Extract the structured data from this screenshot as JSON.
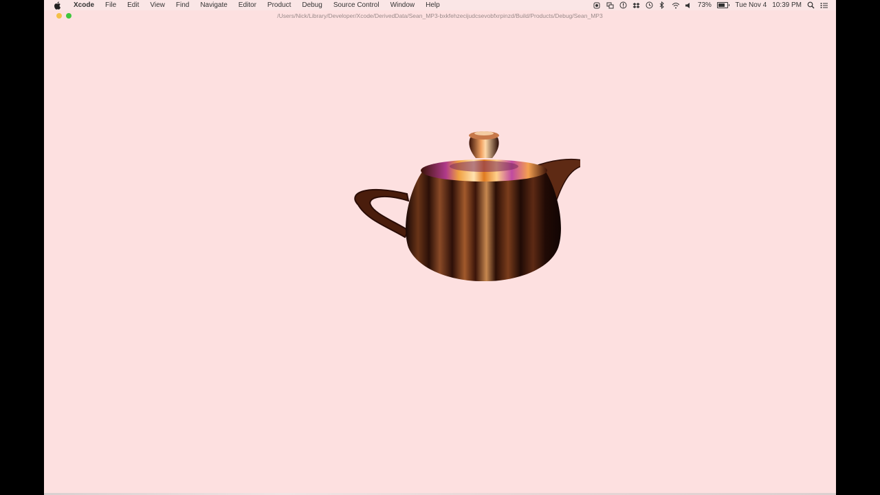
{
  "menubar": {
    "apple_icon": "apple-logo-icon",
    "app_name": "Xcode",
    "items": [
      "File",
      "Edit",
      "View",
      "Find",
      "Navigate",
      "Editor",
      "Product",
      "Debug",
      "Source Control",
      "Window",
      "Help"
    ],
    "status": {
      "battery_percent": "73%",
      "battery_level": 0.73,
      "date": "Tue Nov 4",
      "time": "10:39 PM",
      "icons": [
        "record-icon",
        "screens-icon",
        "info-icon",
        "dropbox-icon",
        "time-machine-icon",
        "bluetooth-icon",
        "wifi-icon",
        "volume-icon",
        "spotlight-icon",
        "notification-center-icon"
      ]
    }
  },
  "window": {
    "path": "/Users/Nick/Library/Developer/Xcode/DerivedData/Sean_MP3-bxkfehzecijudcsevobfxrpinzd/Build/Products/Debug/Sean_MP3"
  },
  "scene": {
    "background": "#fde0e0",
    "object": "teapot-render"
  }
}
